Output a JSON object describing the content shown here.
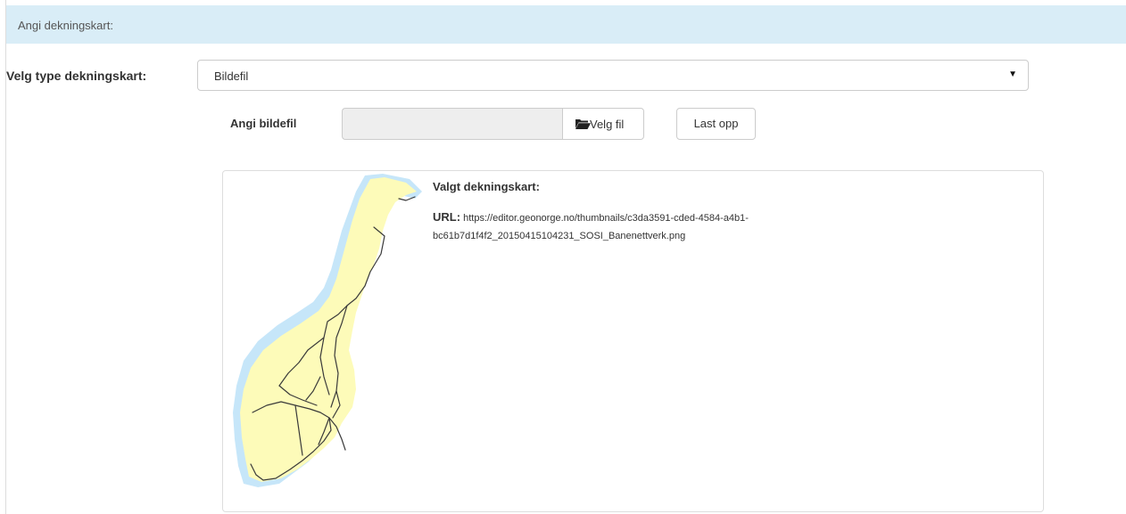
{
  "panel": {
    "heading": "Angi dekningskart:"
  },
  "type_field": {
    "label": "Velg type dekningskart:",
    "selected": "Bildefil"
  },
  "file_field": {
    "label": "Angi bildefil",
    "value": "",
    "browse_label": "Velg fil",
    "upload_label": "Last opp"
  },
  "preview": {
    "title": "Valgt dekningskart:",
    "url_label": "URL:",
    "url_value": "https://editor.geonorge.no/thumbnails/c3da3591-cded-4584-a4b1-bc61b7d1f4f2_20150415104231_SOSI_Banenettverk.png"
  },
  "colors": {
    "heading_bg": "#d9edf7",
    "sea": "#c6e6f9",
    "land": "#fdfbb9",
    "rail": "#3a3a3a"
  },
  "icons": {
    "browse": "folder-open-icon",
    "select": "caret-down-icon"
  }
}
